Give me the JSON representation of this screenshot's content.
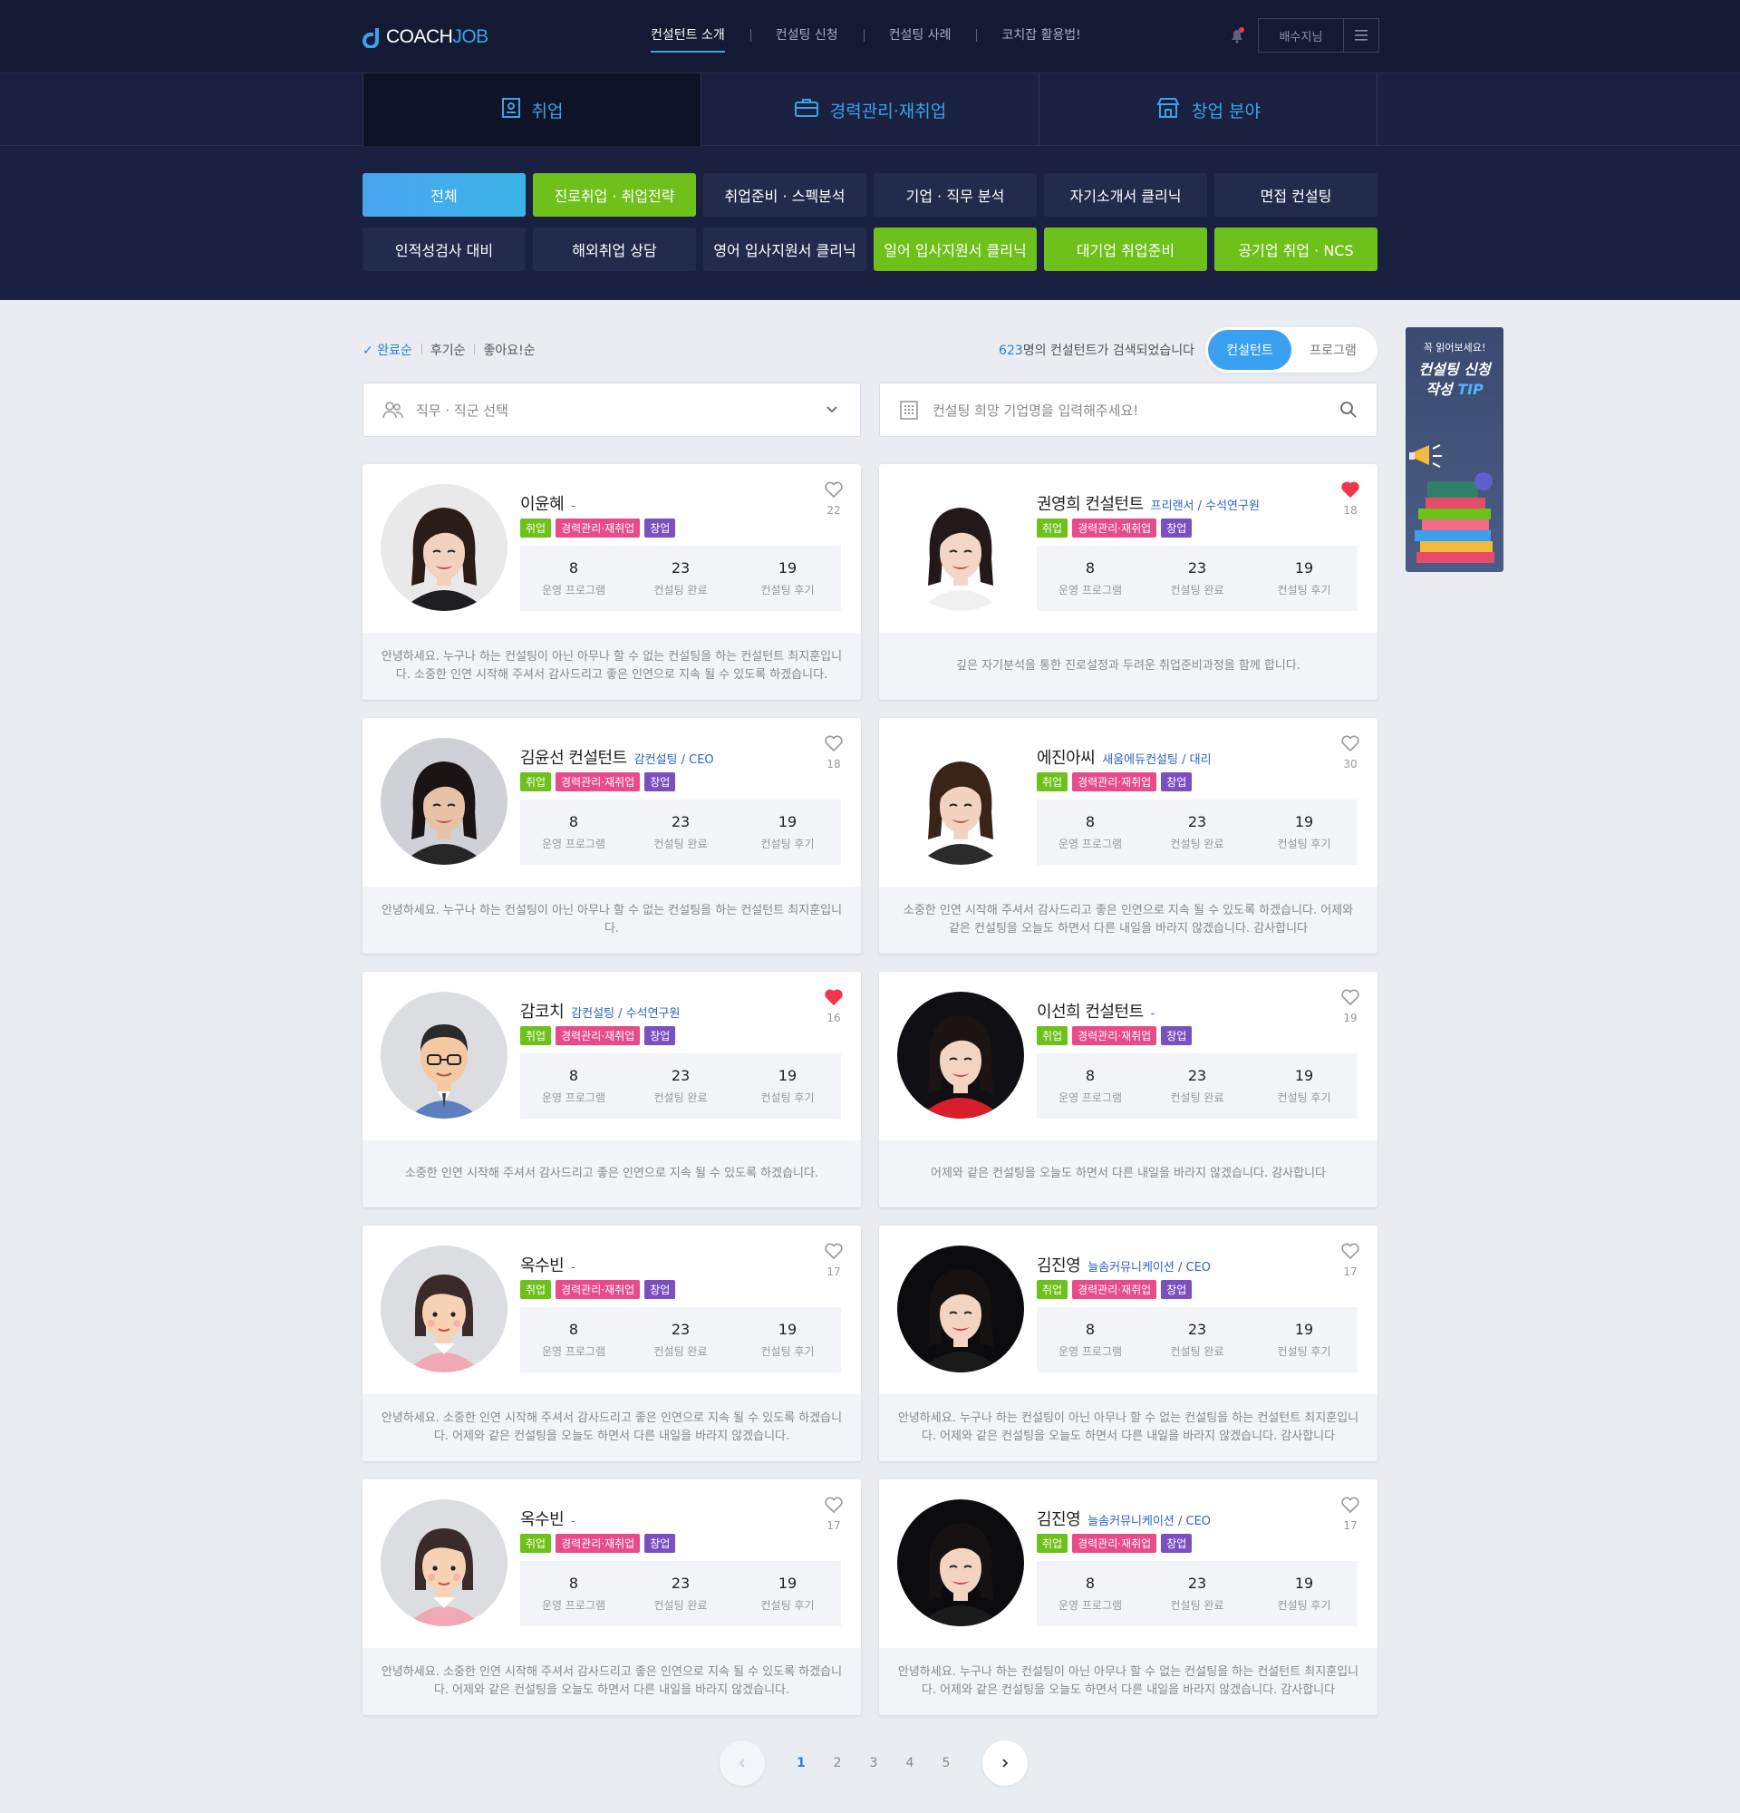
{
  "header": {
    "logo_main": "COACH",
    "logo_accent": "JOB",
    "nav": [
      "컨설턴트 소개",
      "컨설팅 신청",
      "컨설팅 사례",
      "코치잡 활용법!"
    ],
    "user_name": "배수지님"
  },
  "categories": [
    {
      "label": "취업",
      "icon": "id-card-icon"
    },
    {
      "label": "경력관리·재취업",
      "icon": "briefcase-icon"
    },
    {
      "label": "창업 분야",
      "icon": "store-icon"
    }
  ],
  "chips": [
    {
      "label": "전체",
      "style": "blue"
    },
    {
      "label": "진로취업 · 취업전략",
      "style": "green"
    },
    {
      "label": "취업준비 · 스펙분석",
      "style": "dark"
    },
    {
      "label": "기업 · 직무 분석",
      "style": "dark"
    },
    {
      "label": "자기소개서 클리닉",
      "style": "dark"
    },
    {
      "label": "면접 컨설팅",
      "style": "dark"
    },
    {
      "label": "인적성검사 대비",
      "style": "dark"
    },
    {
      "label": "해외취업 상담",
      "style": "dark"
    },
    {
      "label": "영어 입사지원서 클리닉",
      "style": "dark"
    },
    {
      "label": "일어 입사지원서 클리닉",
      "style": "green"
    },
    {
      "label": "대기업 취업준비",
      "style": "green"
    },
    {
      "label": "공기업 취업 · NCS",
      "style": "green"
    }
  ],
  "sort": {
    "options": [
      "완료순",
      "후기순",
      "좋아요!순"
    ],
    "active": "완료순"
  },
  "results": {
    "count": "623",
    "suffix": "명의 컨설턴트가 검색되었습니다",
    "toggle": [
      "컨설턴트",
      "프로그램"
    ]
  },
  "filters": {
    "job_placeholder": "직무 · 직군 선택",
    "company_placeholder": "컨설팅 희망 기업명을 입력해주세요!"
  },
  "stat_labels": [
    "운영 프로그램",
    "컨설팅 완료",
    "컨설팅 후기"
  ],
  "tag_labels": [
    "취업",
    "경력관리·재취업",
    "창업"
  ],
  "consultants": [
    {
      "name": "이윤혜",
      "org": "-",
      "stats": [
        "8",
        "23",
        "19"
      ],
      "likes": "22",
      "liked": false,
      "avatar": "photo-woman-1",
      "desc": "안녕하세요. 누구나 하는 컨설팅이 아닌 아무나 할 수 없는 컨설팅을 하는 컨설턴트 최지훈입니다. 소중한 인연 시작해 주셔서 감사드리고 좋은 인연으로 지속 될 수 있도록 하겠습니다."
    },
    {
      "name": "권영희 컨설턴트",
      "org": "프리랜서 / 수석연구원",
      "stats": [
        "8",
        "23",
        "19"
      ],
      "likes": "18",
      "liked": true,
      "avatar": "photo-woman-2",
      "desc": "깊은 자기분석을 통한 진로설정과 두려운 취업준비과정을 함께 합니다."
    },
    {
      "name": "김윤선 컨설턴트",
      "org": "감컨설팅 / CEO",
      "stats": [
        "8",
        "23",
        "19"
      ],
      "likes": "18",
      "liked": false,
      "avatar": "photo-woman-3",
      "desc": "안녕하세요. 누구나 하는 컨설팅이 아닌 아무나 할 수 없는 컨설팅을 하는 컨설턴트 최지훈입니다."
    },
    {
      "name": "에진아씨",
      "org": "새움에듀컨설팅 / 대리",
      "stats": [
        "8",
        "23",
        "19"
      ],
      "likes": "30",
      "liked": false,
      "avatar": "photo-woman-4",
      "desc": "소중한 인연 시작해 주셔서 감사드리고 좋은 인연으로 지속 될 수 있도록 하겠습니다. 어제와 같은 컨설팅을 오늘도 하면서 다른 내일을 바라지 않겠습니다. 감사합니다"
    },
    {
      "name": "감코치",
      "org": "감컨설팅 / 수석연구원",
      "stats": [
        "8",
        "23",
        "19"
      ],
      "likes": "16",
      "liked": true,
      "avatar": "cartoon-man",
      "desc": "소중한 인연 시작해 주셔서 감사드리고 좋은 인연으로 지속 될 수 있도록 하겠습니다."
    },
    {
      "name": "이선희 컨설턴트",
      "org": "-",
      "stats": [
        "8",
        "23",
        "19"
      ],
      "likes": "19",
      "liked": false,
      "avatar": "photo-woman-5",
      "desc": "어제와 같은 컨설팅을 오늘도 하면서 다른 내일을 바라지 않겠습니다. 감사합니다"
    },
    {
      "name": "옥수빈",
      "org": "-",
      "stats": [
        "8",
        "23",
        "19"
      ],
      "likes": "17",
      "liked": false,
      "avatar": "cartoon-woman",
      "desc": "안녕하세요. 소중한 인연 시작해 주셔서 감사드리고 좋은 인연으로 지속 될 수 있도록 하겠습니다. 어제와 같은 컨설팅을 오늘도 하면서 다른 내일을 바라지 않겠습니다."
    },
    {
      "name": "김진영",
      "org": "늘솜커뮤니케이션 / CEO",
      "stats": [
        "8",
        "23",
        "19"
      ],
      "likes": "17",
      "liked": false,
      "avatar": "photo-woman-6",
      "desc": "안녕하세요. 누구나 하는 컨설팅이 아닌 아무나 할 수 없는 컨설팅을 하는 컨설턴트 최지훈입니다. 어제와 같은 컨설팅을 오늘도 하면서 다른 내일을 바라지 않겠습니다. 감사합니다"
    },
    {
      "name": "옥수빈",
      "org": "-",
      "stats": [
        "8",
        "23",
        "19"
      ],
      "likes": "17",
      "liked": false,
      "avatar": "cartoon-woman",
      "desc": "안녕하세요. 소중한 인연 시작해 주셔서 감사드리고 좋은 인연으로 지속 될 수 있도록 하겠습니다. 어제와 같은 컨설팅을 오늘도 하면서 다른 내일을 바라지 않겠습니다."
    },
    {
      "name": "김진영",
      "org": "늘솜커뮤니케이션 / CEO",
      "stats": [
        "8",
        "23",
        "19"
      ],
      "likes": "17",
      "liked": false,
      "avatar": "photo-woman-6",
      "desc": "안녕하세요. 누구나 하는 컨설팅이 아닌 아무나 할 수 없는 컨설팅을 하는 컨설턴트 최지훈입니다. 어제와 같은 컨설팅을 오늘도 하면서 다른 내일을 바라지 않겠습니다. 감사합니다"
    }
  ],
  "banner": {
    "small": "꼭 읽어보세요!",
    "line1": "컨설팅 신청",
    "line2": "작성",
    "tip": "TIP"
  },
  "pagination": {
    "pages": [
      "1",
      "2",
      "3",
      "4",
      "5"
    ],
    "current": "1"
  },
  "colors": {
    "header_bg": "#141a33",
    "accent_blue": "#3aa3e8",
    "chip_green": "#6ec11a",
    "tag_pink": "#e84b8a",
    "tag_purple": "#7a4fc0",
    "heart_red": "#f0364b"
  }
}
